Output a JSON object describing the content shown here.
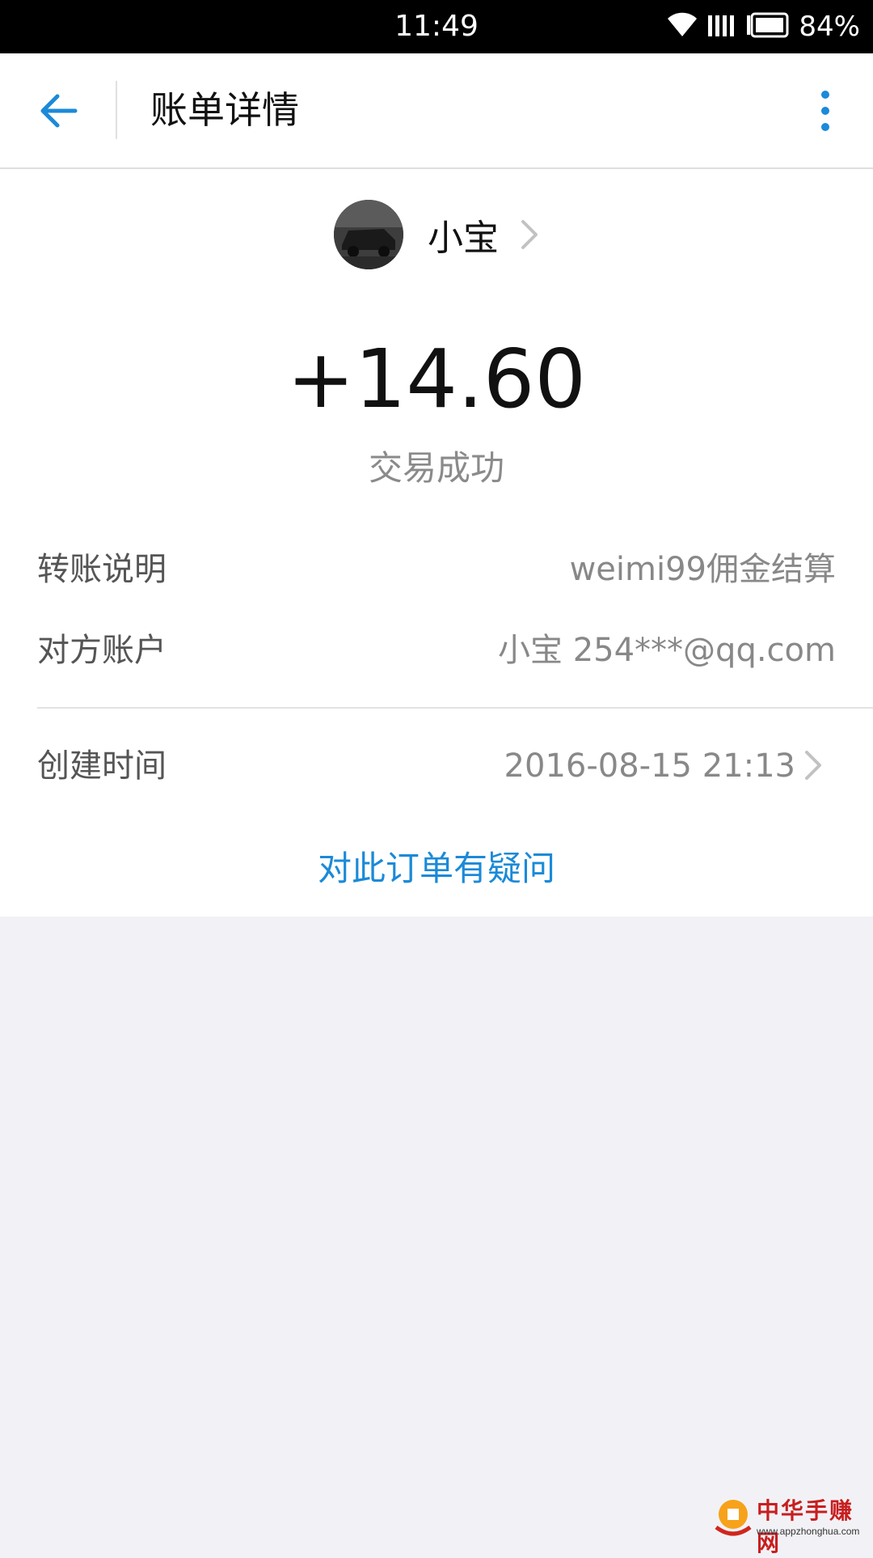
{
  "status_bar": {
    "time": "11:49",
    "battery": "84%",
    "icons": [
      "wifi-icon",
      "signal-icon",
      "battery-icon"
    ]
  },
  "header": {
    "title": "账单详情",
    "back_icon": "arrow-left-icon",
    "more_icon": "more-vertical-icon",
    "accent_color": "#1b8ad8"
  },
  "payee": {
    "name": "小宝",
    "avatar_icon": "car-photo-avatar"
  },
  "transaction": {
    "amount": "+14.60",
    "status": "交易成功"
  },
  "details": [
    {
      "label": "转账说明",
      "value": "weimi99佣金结算"
    },
    {
      "label": "对方账户",
      "value": "小宝 254***@qq.com"
    },
    {
      "label": "创建时间",
      "value": "2016-08-15 21:13"
    }
  ],
  "question_link": "对此订单有疑问",
  "watermark": {
    "text": "中华手赚网",
    "url": "www.appzhonghua.com"
  }
}
